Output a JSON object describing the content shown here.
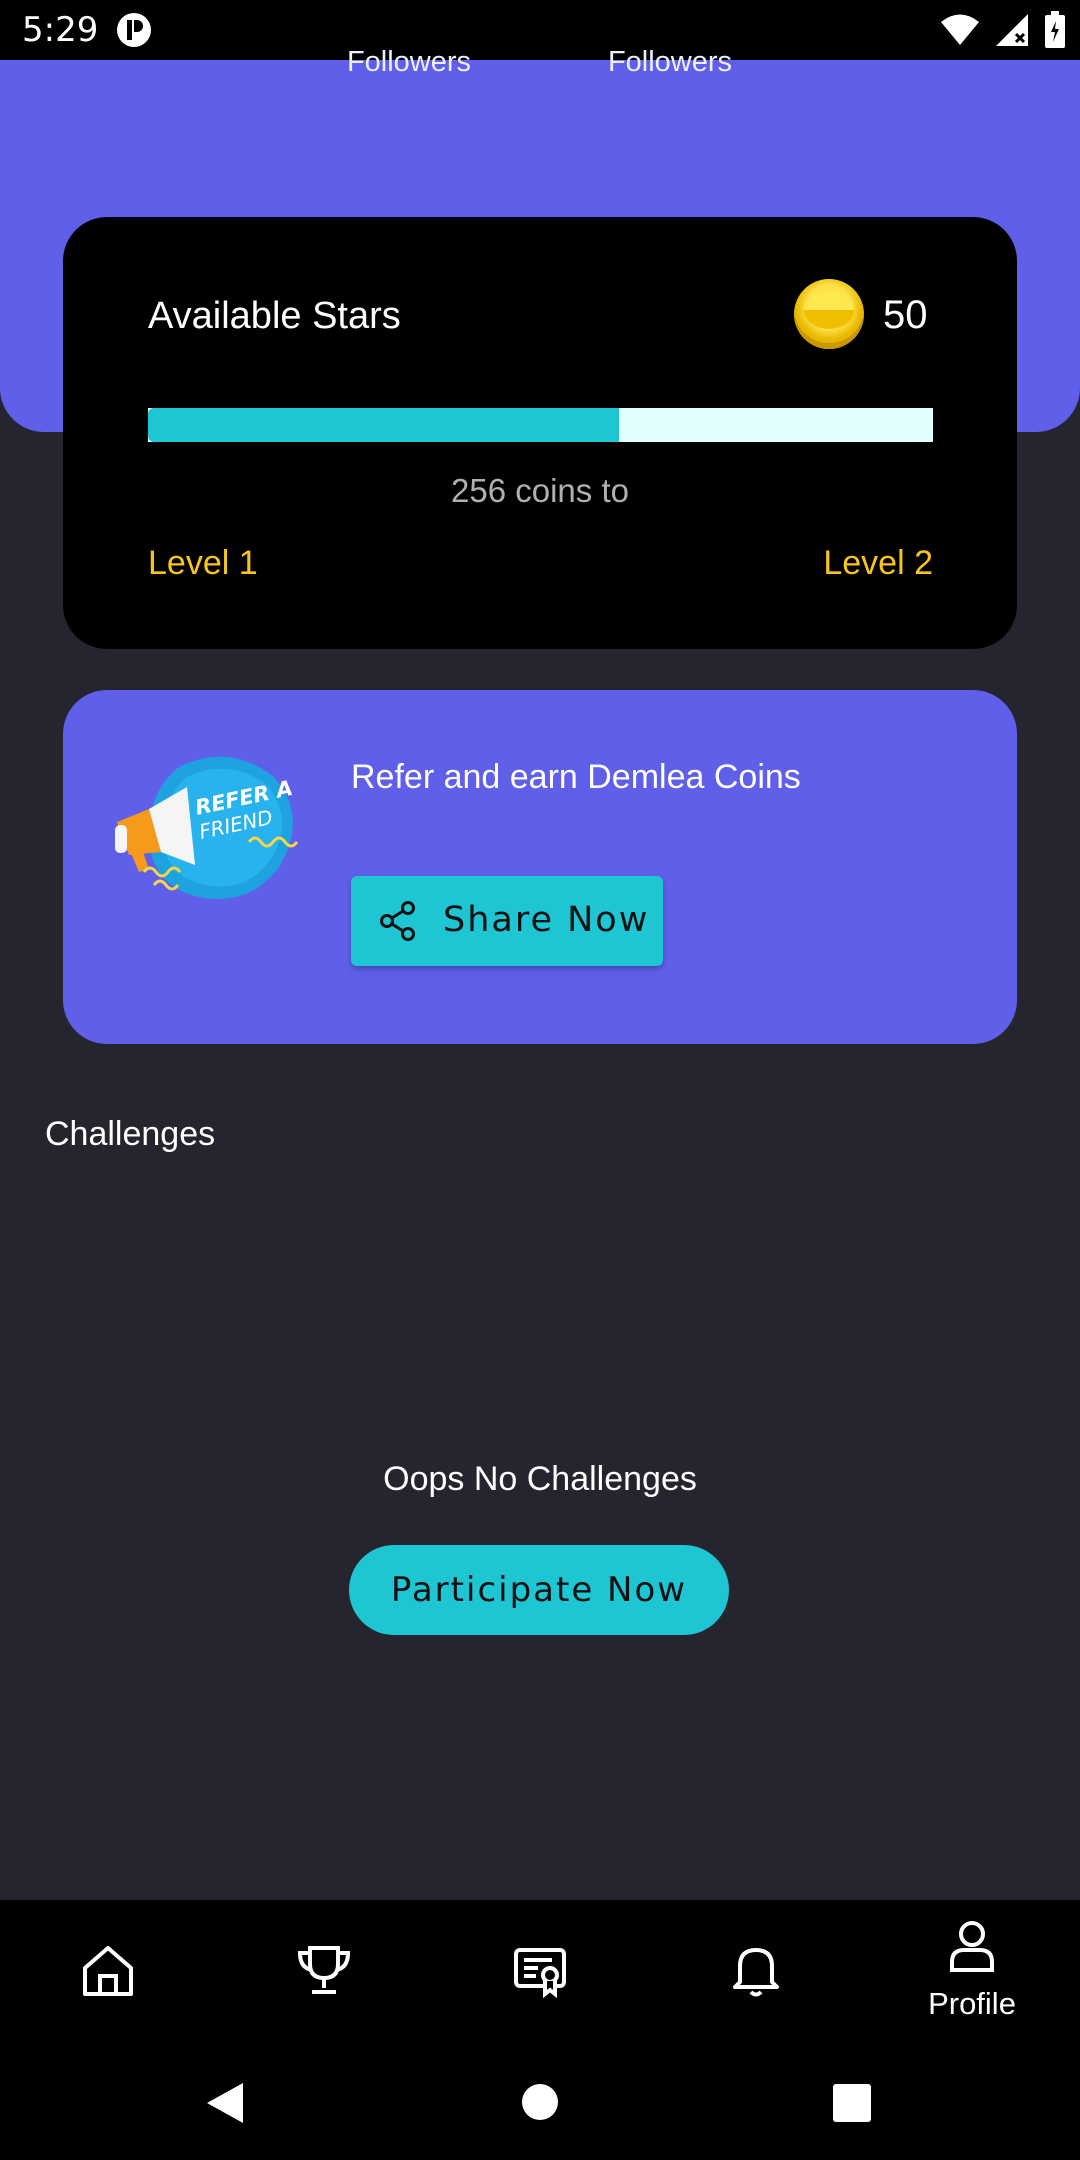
{
  "status_bar": {
    "time": "5:29"
  },
  "header": {
    "followers_left": "Followers",
    "followers_right": "Followers"
  },
  "stars": {
    "title": "Available Stars",
    "count": "50",
    "progress_fraction": 0.6,
    "coins_to_text": "256 coins to",
    "level_from": "Level 1",
    "level_to": "Level 2"
  },
  "refer": {
    "text": "Refer and earn Demlea Coins",
    "button_label": "Share Now",
    "illustration_line1": "REFER A",
    "illustration_line2": "FRIEND"
  },
  "challenges": {
    "title": "Challenges",
    "empty_text": "Oops No Challenges",
    "button_label": "Participate Now"
  },
  "bottom_nav": {
    "items": [
      {
        "icon": "home-icon"
      },
      {
        "icon": "trophy-icon"
      },
      {
        "icon": "certificate-icon"
      },
      {
        "icon": "bell-icon"
      },
      {
        "icon": "person-icon",
        "label": "Profile"
      }
    ]
  },
  "colors": {
    "accent_purple": "#5f5fea",
    "accent_cyan": "#1ec6d4",
    "level_yellow": "#f7c51b",
    "background": "#252530"
  }
}
